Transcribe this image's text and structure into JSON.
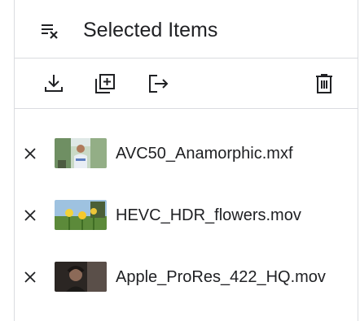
{
  "header": {
    "title": "Selected Items",
    "clear_icon": "clear-selection-icon"
  },
  "toolbar": {
    "buttons": [
      {
        "name": "download-icon"
      },
      {
        "name": "add-to-collection-icon"
      },
      {
        "name": "export-icon"
      },
      {
        "name": "delete-icon"
      }
    ]
  },
  "items": [
    {
      "filename": "AVC50_Anamorphic.mxf",
      "remove_icon": "close-icon"
    },
    {
      "filename": "HEVC_HDR_flowers.mov",
      "remove_icon": "close-icon"
    },
    {
      "filename": "Apple_ProRes_422_HQ.mov",
      "remove_icon": "close-icon"
    }
  ],
  "colors": {
    "text": "#202124",
    "divider": "#dadce0",
    "icon": "#202124"
  }
}
